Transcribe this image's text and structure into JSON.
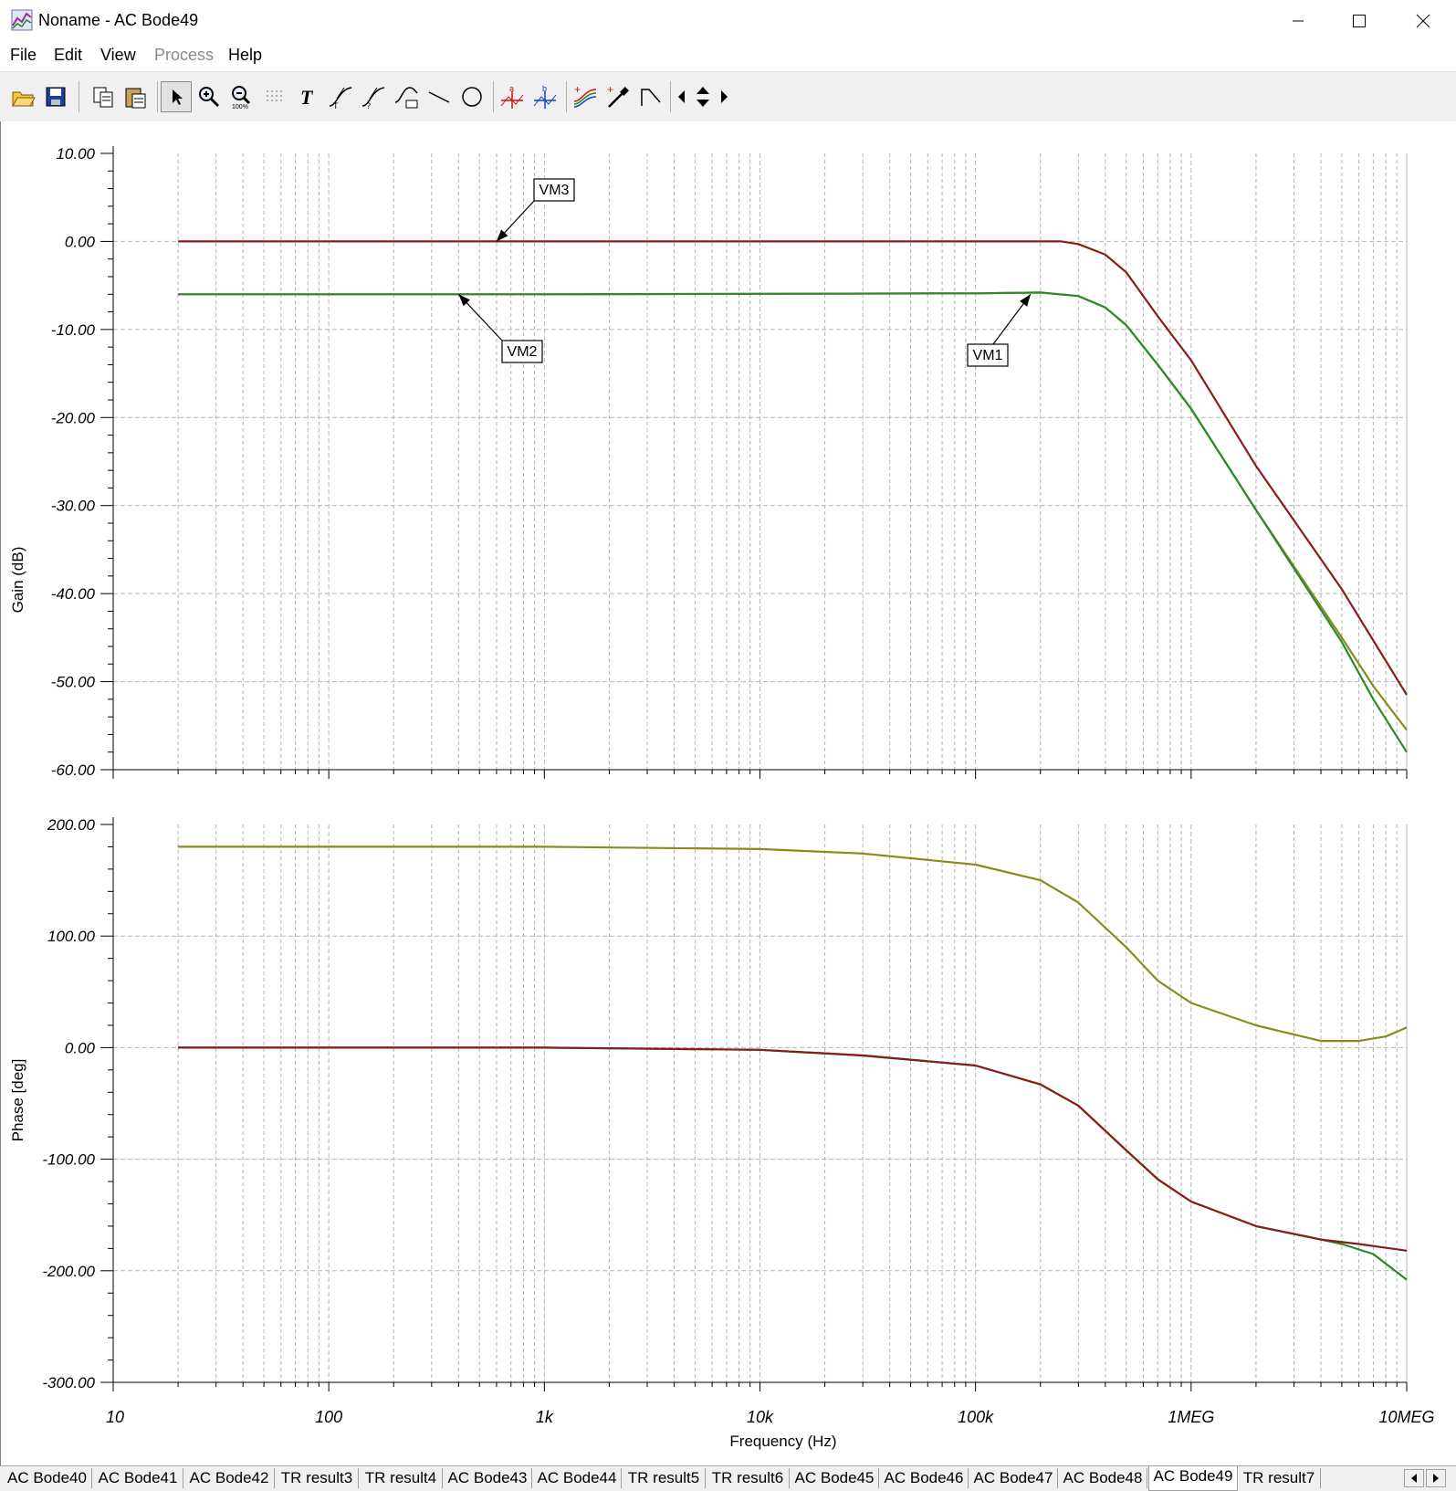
{
  "window": {
    "title": "Noname - AC Bode49",
    "icon": "analysis-chart-icon",
    "controls": [
      "minimize-icon",
      "maximize-icon",
      "close-icon"
    ]
  },
  "menu": {
    "file": "File",
    "edit": "Edit",
    "view": "View",
    "process": "Process",
    "help": "Help"
  },
  "toolbar": {
    "icons": [
      "open-icon",
      "save-icon",
      "copy-icon",
      "paste-icon",
      "pointer-icon",
      "zoom-in-icon",
      "zoom-100-icon",
      "grid-icon",
      "text-icon",
      "curve-label-icon",
      "curve-label-2-icon",
      "axis-label-icon",
      "line-icon",
      "circle-icon",
      "cursor-a-icon",
      "cursor-b-icon",
      "add-curve-icon",
      "probe-icon",
      "marker-icon",
      "scroll-left-icon",
      "scroll-up-down-icon",
      "scroll-right-icon"
    ]
  },
  "colors": {
    "vm3": "#8b1c1c",
    "vm2": "#2b8a2b",
    "vm1": "#8b8b1c",
    "grid": "#b4b4b4"
  },
  "chart_data": [
    {
      "type": "line",
      "title": "",
      "xlabel": "",
      "ylabel": "Gain (dB)",
      "xscale": "log",
      "xlim": [
        10,
        10000000
      ],
      "ylim": [
        -60,
        10
      ],
      "yticks": [
        "10.00",
        "0.00",
        "-10.00",
        "-20.00",
        "-30.00",
        "-40.00",
        "-50.00",
        "-60.00"
      ],
      "grid": true,
      "annotations": [
        {
          "text": "VM3",
          "target": [
            600,
            0
          ]
        },
        {
          "text": "VM2",
          "target": [
            400,
            -6
          ]
        },
        {
          "text": "VM1",
          "target": [
            180000,
            -6
          ]
        }
      ],
      "series": [
        {
          "name": "VM3",
          "color": "#8b1c1c",
          "x": [
            20,
            1000,
            100000,
            250000,
            300000,
            400000,
            500000,
            700000,
            1000000,
            2000000,
            5000000,
            10000000
          ],
          "y": [
            0,
            0,
            0,
            0,
            -0.3,
            -1.5,
            -3.5,
            -8.5,
            -13.5,
            -25.5,
            -39.5,
            -51.5
          ]
        },
        {
          "name": "VM1",
          "color": "#8b8b1c",
          "x": [
            20,
            1000,
            100000,
            200000,
            300000,
            400000,
            500000,
            700000,
            1000000,
            2000000,
            5000000,
            7000000,
            10000000
          ],
          "y": [
            -6,
            -6,
            -5.9,
            -5.8,
            -6.2,
            -7.5,
            -9.5,
            -14,
            -19,
            -30.5,
            -45,
            -50.5,
            -55.5
          ]
        },
        {
          "name": "VM2",
          "color": "#2b8a2b",
          "x": [
            20,
            1000,
            100000,
            200000,
            300000,
            400000,
            500000,
            700000,
            1000000,
            2000000,
            5000000,
            7000000,
            10000000
          ],
          "y": [
            -6,
            -6,
            -5.9,
            -5.8,
            -6.2,
            -7.5,
            -9.5,
            -14,
            -19,
            -30.5,
            -45.5,
            -52,
            -58
          ]
        }
      ]
    },
    {
      "type": "line",
      "title": "",
      "xlabel": "Frequency (Hz)",
      "ylabel": "Phase [deg]",
      "xscale": "log",
      "xlim": [
        10,
        10000000
      ],
      "ylim": [
        -300,
        200
      ],
      "yticks": [
        "200.00",
        "100.00",
        "0.00",
        "-100.00",
        "-200.00",
        "-300.00"
      ],
      "xticks": [
        "10",
        "100",
        "1k",
        "10k",
        "100k",
        "1MEG",
        "10MEG"
      ],
      "grid": true,
      "series": [
        {
          "name": "",
          "color": "#8b8b1c",
          "x": [
            20,
            1000,
            10000,
            30000,
            100000,
            200000,
            300000,
            500000,
            700000,
            1000000,
            2000000,
            4000000,
            6000000,
            8000000,
            10000000
          ],
          "y": [
            180,
            180,
            178,
            174,
            164,
            150,
            130,
            90,
            60,
            40,
            20,
            6,
            6,
            10,
            18
          ]
        },
        {
          "name": "",
          "color": "#2b8a2b",
          "x": [
            20,
            1000,
            10000,
            30000,
            100000,
            200000,
            300000,
            500000,
            700000,
            1000000,
            2000000,
            4000000,
            5000000,
            7000000,
            10000000
          ],
          "y": [
            0,
            0,
            -2,
            -7,
            -16,
            -33,
            -52,
            -92,
            -118,
            -138,
            -160,
            -172,
            -176,
            -185,
            -208
          ]
        },
        {
          "name": "",
          "color": "#8b1c1c",
          "x": [
            20,
            1000,
            10000,
            30000,
            100000,
            200000,
            300000,
            500000,
            700000,
            1000000,
            2000000,
            4000000,
            6000000,
            10000000
          ],
          "y": [
            0,
            0,
            -2,
            -7,
            -16,
            -33,
            -52,
            -92,
            -118,
            -138,
            -160,
            -172,
            -176,
            -182
          ]
        }
      ]
    }
  ],
  "tabs": [
    "AC Bode40",
    "AC Bode41",
    "AC Bode42",
    "TR result3",
    "TR result4",
    "AC Bode43",
    "AC Bode44",
    "TR result5",
    "TR result6",
    "AC Bode45",
    "AC Bode46",
    "AC Bode47",
    "AC Bode48",
    "AC Bode49",
    "TR result7"
  ],
  "active_tab": "AC Bode49"
}
